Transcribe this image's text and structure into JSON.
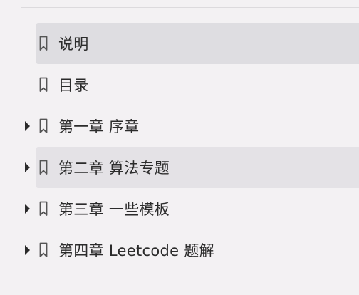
{
  "outline": {
    "items": [
      {
        "label": "说明",
        "expandable": false,
        "highlighted": true
      },
      {
        "label": "目录",
        "expandable": false,
        "highlighted": false
      },
      {
        "label": "第一章 序章",
        "expandable": true,
        "highlighted": false
      },
      {
        "label": "第二章 算法专题",
        "expandable": true,
        "highlighted": true
      },
      {
        "label": "第三章 一些模板",
        "expandable": true,
        "highlighted": false
      },
      {
        "label": "第四章 Leetcode 题解",
        "expandable": true,
        "highlighted": false
      }
    ]
  },
  "icons": {
    "bookmark": "bookmark-icon",
    "expand": "caret-right-icon"
  },
  "colors": {
    "background": "#f3f1f3",
    "highlight": "#dedde1",
    "text": "#2b2b2b",
    "icon": "#555555"
  }
}
